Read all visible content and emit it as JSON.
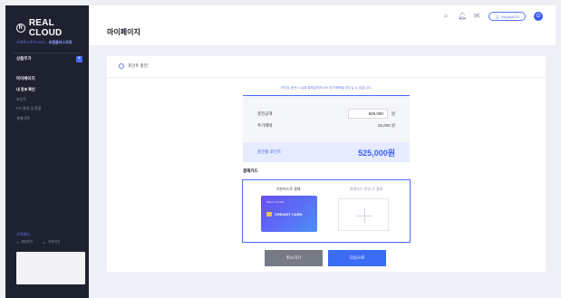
{
  "sidebar": {
    "logo": "REAL CLOUD",
    "plan_prefix": "스마트스토어 2021 -",
    "plan_name": "프렌플러스무료",
    "product_add": "상품추가",
    "section_title": "마이페이지",
    "items": [
      {
        "label": "내 정보 확인",
        "active": true
      },
      {
        "label": "포인트",
        "active": false
      },
      {
        "label": "PG 결제 및 환불",
        "active": false
      },
      {
        "label": "결제내역",
        "active": false
      }
    ],
    "support_title": "고객센터",
    "contact_phone": "채팅하기",
    "contact_mail": "전화하기"
  },
  "header": {
    "page_title": "마이페이지",
    "user_label": "hapaka123",
    "icons": [
      "search-icon",
      "bell-icon",
      "message-icon"
    ]
  },
  "card": {
    "title": "포인트 충전",
    "notice": "포인트 충전시 실제 결제금액의 5% 추가혜택을 받으실 수 있습니다.",
    "charge_label": "충전금액",
    "charge_value": "500,000",
    "charge_unit": "원",
    "bonus_label": "추가혜택",
    "bonus_value": "25,000 원",
    "total_label": "충전될 포인트",
    "total_value": "525,000원",
    "pay_label": "결제카드",
    "pay_left": "기본카드로 결제",
    "pay_right": "결제카드 변경 후 결제",
    "card_brand": "REAL CLOUD",
    "card_text": "CREADIT CARD",
    "cancel_button": "취소하기",
    "next_button": "다음으로"
  },
  "colors": {
    "accent": "#3b5ef5",
    "sidebar_bg": "#1e2230",
    "cancel_bg": "#757a85"
  }
}
